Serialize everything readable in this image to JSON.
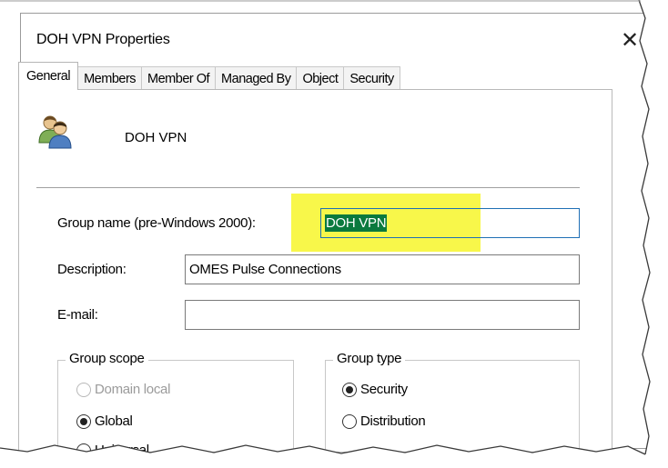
{
  "window": {
    "title": "DOH VPN Properties",
    "close_glyph": "✕"
  },
  "tabs": [
    {
      "label": "General",
      "active": true
    },
    {
      "label": "Members"
    },
    {
      "label": "Member Of"
    },
    {
      "label": "Managed By"
    },
    {
      "label": "Object"
    },
    {
      "label": "Security"
    }
  ],
  "general": {
    "group_icon": "users-group-icon",
    "group_name": "DOH VPN",
    "pre2000": {
      "label": "Group name (pre-Windows 2000):",
      "value": "DOH VPN"
    },
    "description": {
      "label": "Description:",
      "value": "OMES Pulse Connections"
    },
    "email": {
      "label": "E-mail:",
      "value": ""
    },
    "group_scope": {
      "legend": "Group scope",
      "options": [
        {
          "label": "Domain local",
          "checked": false,
          "disabled": true
        },
        {
          "label": "Global",
          "checked": true,
          "disabled": false
        },
        {
          "label": "Universal",
          "checked": false,
          "disabled": false
        }
      ]
    },
    "group_type": {
      "legend": "Group type",
      "options": [
        {
          "label": "Security",
          "checked": true
        },
        {
          "label": "Distribution",
          "checked": false
        }
      ]
    }
  },
  "colors": {
    "highlight": "#f8f74a",
    "selection": "#0a7a3e",
    "focus_border": "#1f6fb5"
  }
}
